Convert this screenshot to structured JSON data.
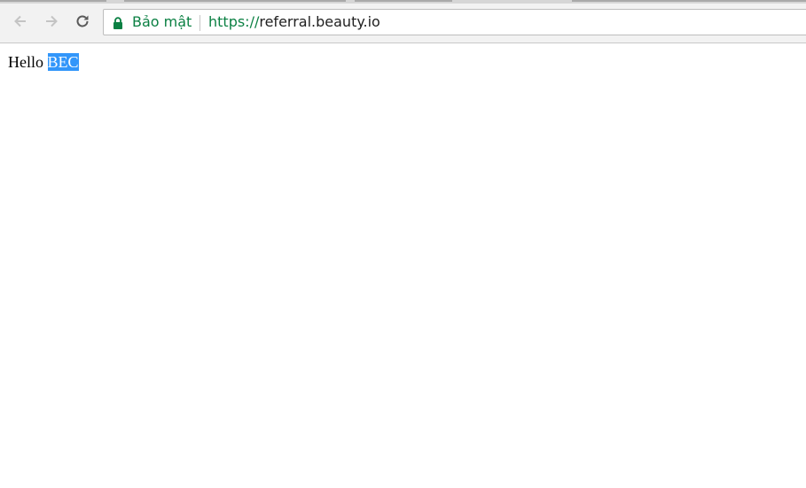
{
  "browser": {
    "icons": {
      "back": "arrow-left-icon",
      "forward": "arrow-right-icon",
      "reload": "reload-icon",
      "secure": "lock-icon"
    },
    "omnibox": {
      "secure_label": "Bảo mật",
      "url_scheme": "https://",
      "url_host": "referral.beauty.io"
    },
    "colors": {
      "secure_green": "#0b8043",
      "selection_blue": "#3296fa"
    }
  },
  "page": {
    "greeting": "Hello",
    "highlighted_name": "BEC"
  }
}
